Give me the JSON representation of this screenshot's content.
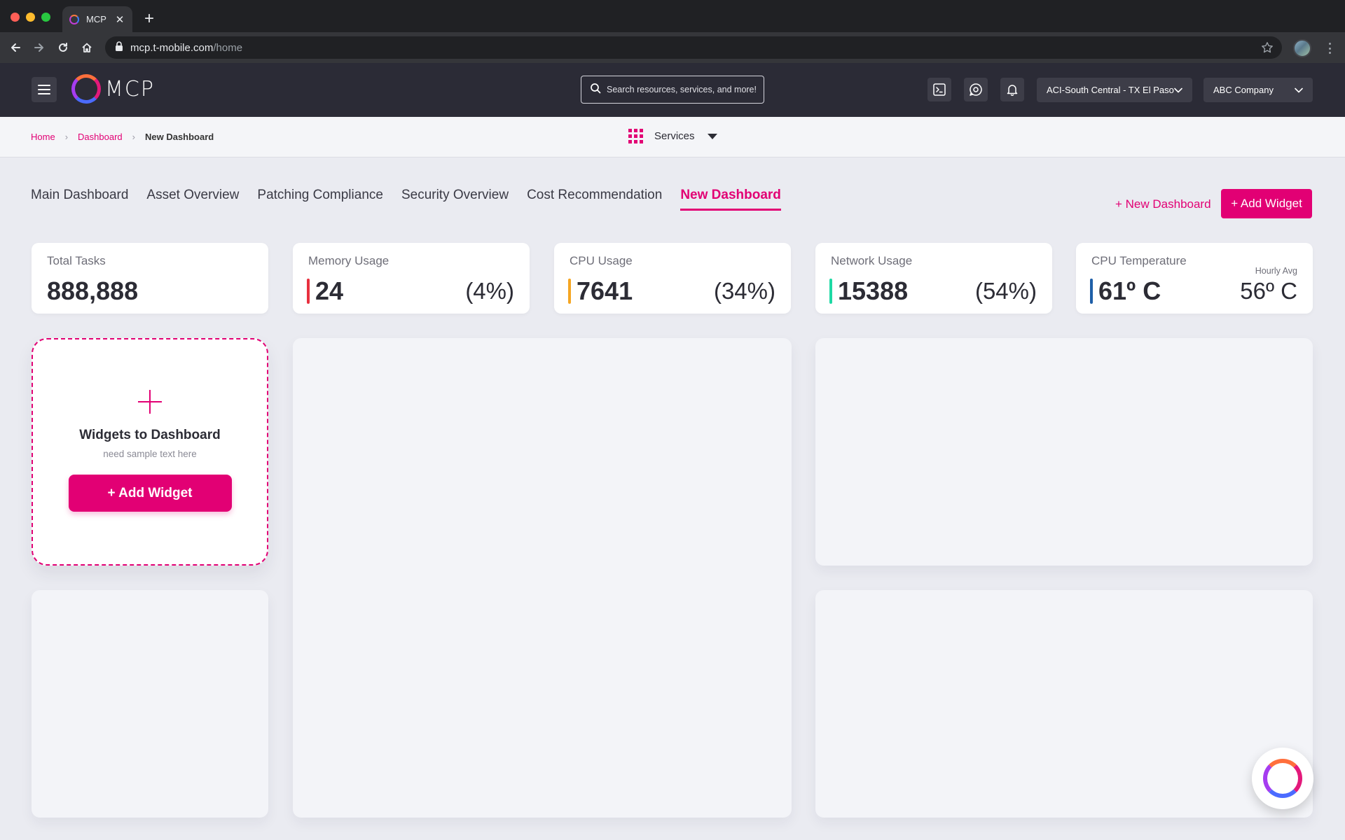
{
  "browser": {
    "tab_title": "MCP",
    "url_host": "mcp.t-mobile.com",
    "url_path": "/home"
  },
  "header": {
    "logo_text": "MCP",
    "search_placeholder": "Search resources, services, and more!",
    "region_select": "ACI-South Central - TX El Paso",
    "company_select": "ABC Company"
  },
  "breadcrumb": {
    "home": "Home",
    "dashboard": "Dashboard",
    "current": "New Dashboard"
  },
  "services_label": "Services",
  "tabs": [
    {
      "label": "Main Dashboard"
    },
    {
      "label": "Asset Overview"
    },
    {
      "label": "Patching Compliance"
    },
    {
      "label": "Security Overview"
    },
    {
      "label": "Cost Recommendation"
    },
    {
      "label": "New Dashboard",
      "active": true
    }
  ],
  "actions": {
    "new_dashboard": "+ New Dashboard",
    "add_widget": "+ Add Widget"
  },
  "stats": {
    "total_tasks": {
      "label": "Total Tasks",
      "value": "888,888"
    },
    "memory": {
      "label": "Memory Usage",
      "value": "24",
      "pct": "(4%)",
      "color": "#e8303f"
    },
    "cpu": {
      "label": "CPU Usage",
      "value": "7641",
      "pct": "(34%)",
      "color": "#f5a623"
    },
    "network": {
      "label": "Network Usage",
      "value": "15388",
      "pct": "(54%)",
      "color": "#1ed9a4"
    },
    "temperature": {
      "label": "CPU Temperature",
      "value": "61º C",
      "sub_label": "Hourly Avg",
      "avg": "56º C",
      "color": "#1f5fa8"
    }
  },
  "add_card": {
    "title": "Widgets to Dashboard",
    "subtitle": "need sample text here",
    "button": "+ Add Widget"
  },
  "colors": {
    "brand": "#e20074",
    "header_bg": "#2b2b36",
    "page_bg": "#eaebf1"
  }
}
